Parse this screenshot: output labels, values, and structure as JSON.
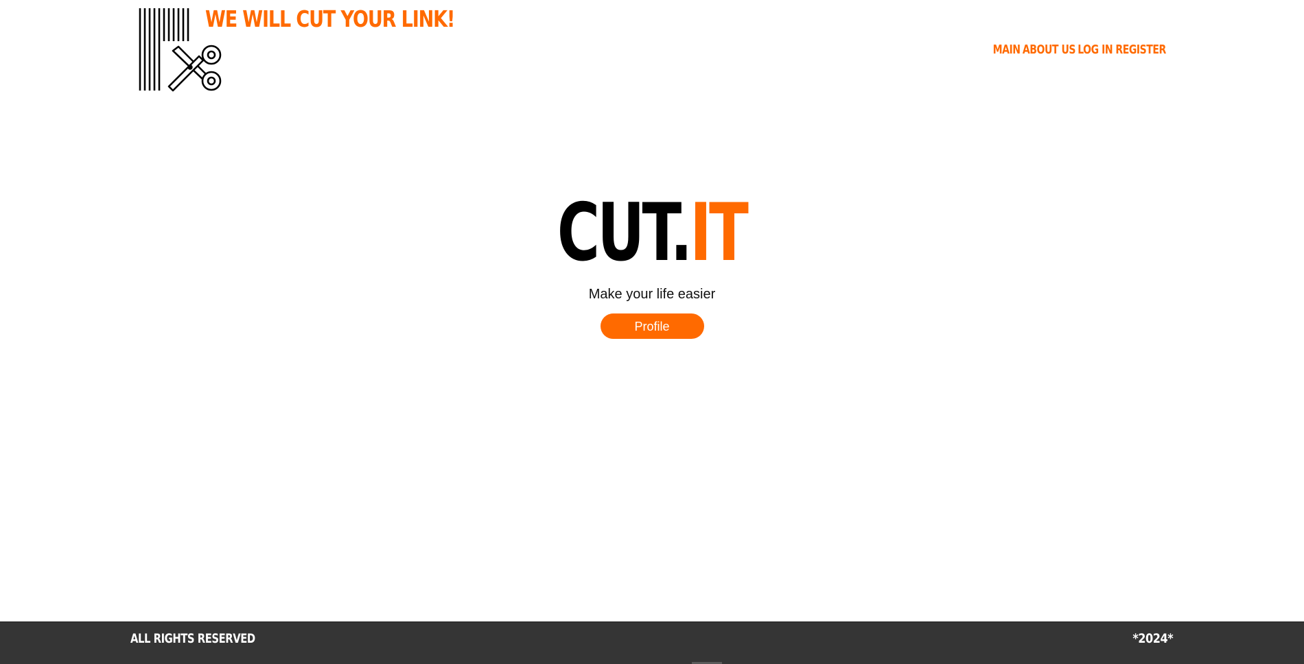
{
  "header": {
    "tagline": "WE WILL CUT YOUR LINK!",
    "logo_icon": "barcode-scissors-icon",
    "nav": [
      {
        "label": "MAIN"
      },
      {
        "label": "ABOUT US"
      },
      {
        "label": "LOG IN"
      },
      {
        "label": "REGISTER"
      }
    ]
  },
  "hero": {
    "brand_main": "CUT.",
    "brand_accent": "IT",
    "subtitle": "Make your life easier",
    "profile_button": "Profile"
  },
  "footer": {
    "left": "ALL RIGHTS RESERVED",
    "right": "*2024*"
  },
  "colors": {
    "accent": "#ff6a00",
    "footer_bg": "#353535",
    "text": "#000000"
  }
}
